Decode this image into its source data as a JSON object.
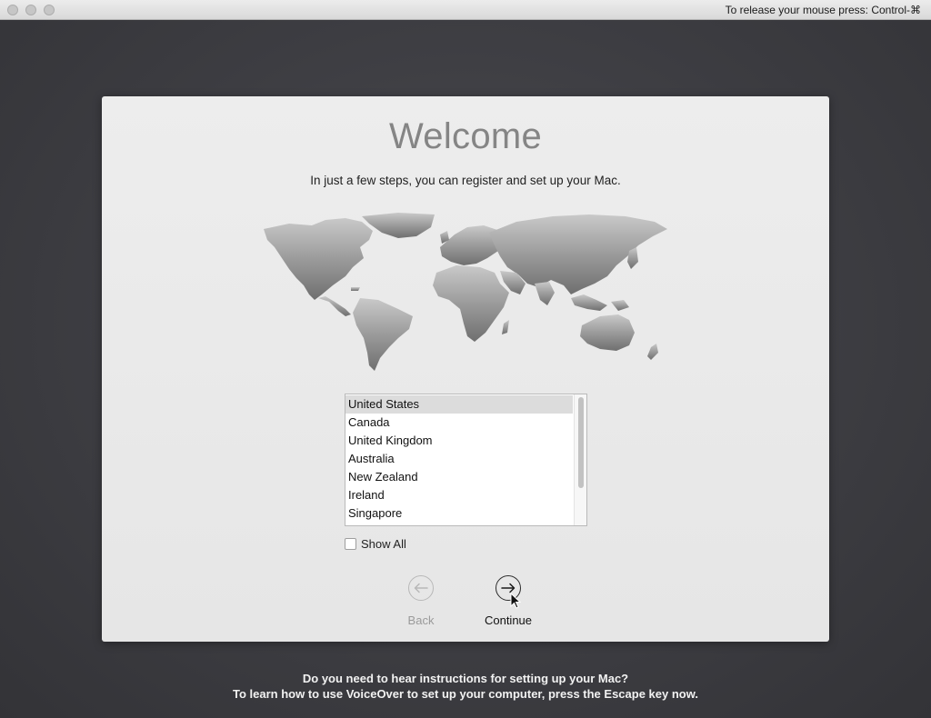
{
  "titlebar": {
    "release_hint": "To release your mouse press: Control-⌘"
  },
  "welcome": {
    "title": "Welcome",
    "subtitle": "In just a few steps, you can register and set up your Mac."
  },
  "country_list": {
    "items": [
      {
        "label": "United States",
        "selected": true
      },
      {
        "label": "Canada",
        "selected": false
      },
      {
        "label": "United Kingdom",
        "selected": false
      },
      {
        "label": "Australia",
        "selected": false
      },
      {
        "label": "New Zealand",
        "selected": false
      },
      {
        "label": "Ireland",
        "selected": false
      },
      {
        "label": "Singapore",
        "selected": false
      }
    ]
  },
  "show_all": {
    "label": "Show All",
    "checked": false
  },
  "navigation": {
    "back_label": "Back",
    "back_enabled": false,
    "continue_label": "Continue",
    "continue_enabled": true
  },
  "voiceover": {
    "line1": "Do you need to hear instructions for setting up your Mac?",
    "line2": "To learn how to use VoiceOver to set up your computer, press the Escape key now."
  },
  "icons": {
    "back": "arrow-left-circle-icon",
    "continue": "arrow-right-circle-icon",
    "map": "world-map-icon"
  },
  "colors": {
    "backdrop": "#3d3d42",
    "panel": "#ececec",
    "title": "#858585",
    "selected_row": "#dcdcdc",
    "disabled": "#9a9a9a"
  }
}
